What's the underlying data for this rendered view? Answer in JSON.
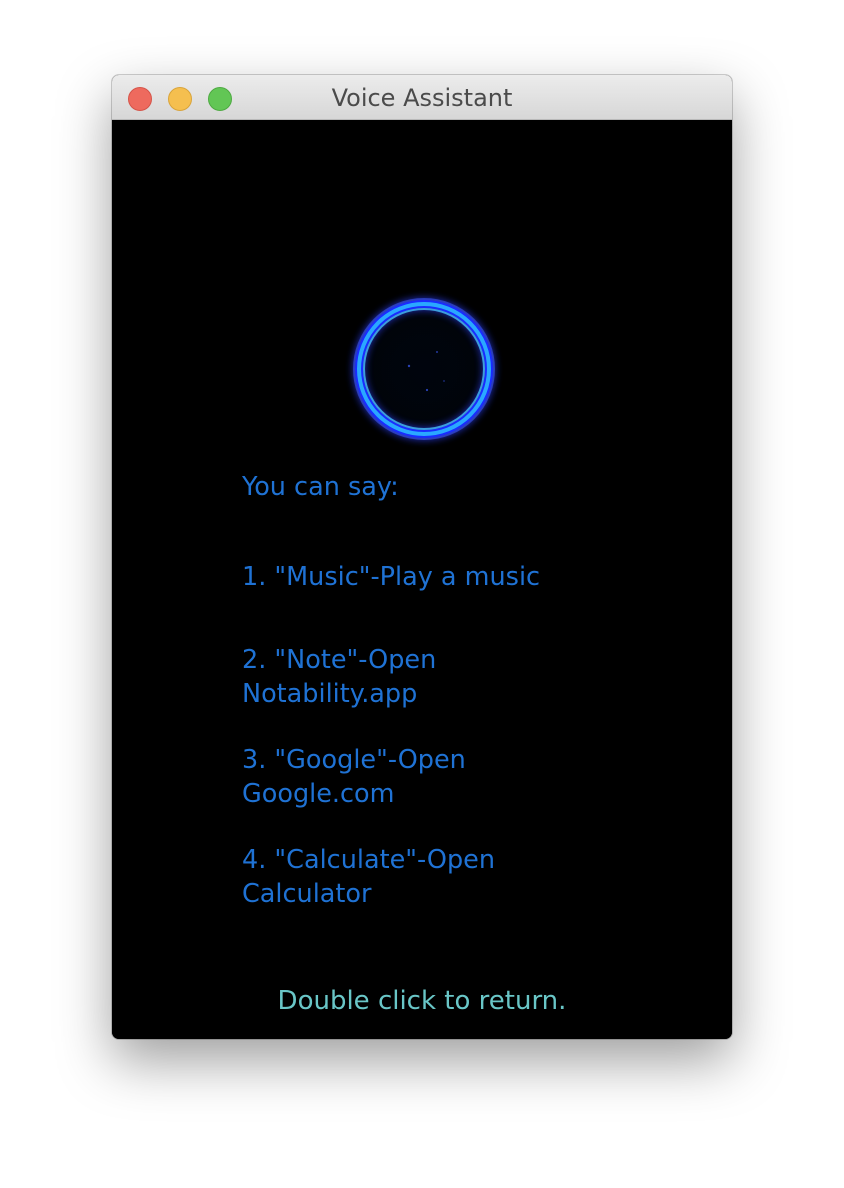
{
  "window": {
    "title": "Voice Assistant"
  },
  "controls": {
    "close": "close",
    "minimize": "minimize",
    "zoom": "zoom"
  },
  "assistant": {
    "prompt": "You can say:",
    "commands": [
      {
        "line1": "1. \"Music\"-Play a music"
      },
      {
        "line1": "2. \"Note\"-Open",
        "line2": "Notability.app"
      },
      {
        "line1": "3. \"Google\"-Open",
        "line2": "Google.com"
      },
      {
        "line1": "4. \"Calculate\"-Open",
        "line2": "Calculator"
      }
    ],
    "hint": "Double click to return."
  },
  "colors": {
    "background": "#000000",
    "text": "#1f72d4",
    "hint": "#69c6c7",
    "ring": "#2aa8ff"
  }
}
